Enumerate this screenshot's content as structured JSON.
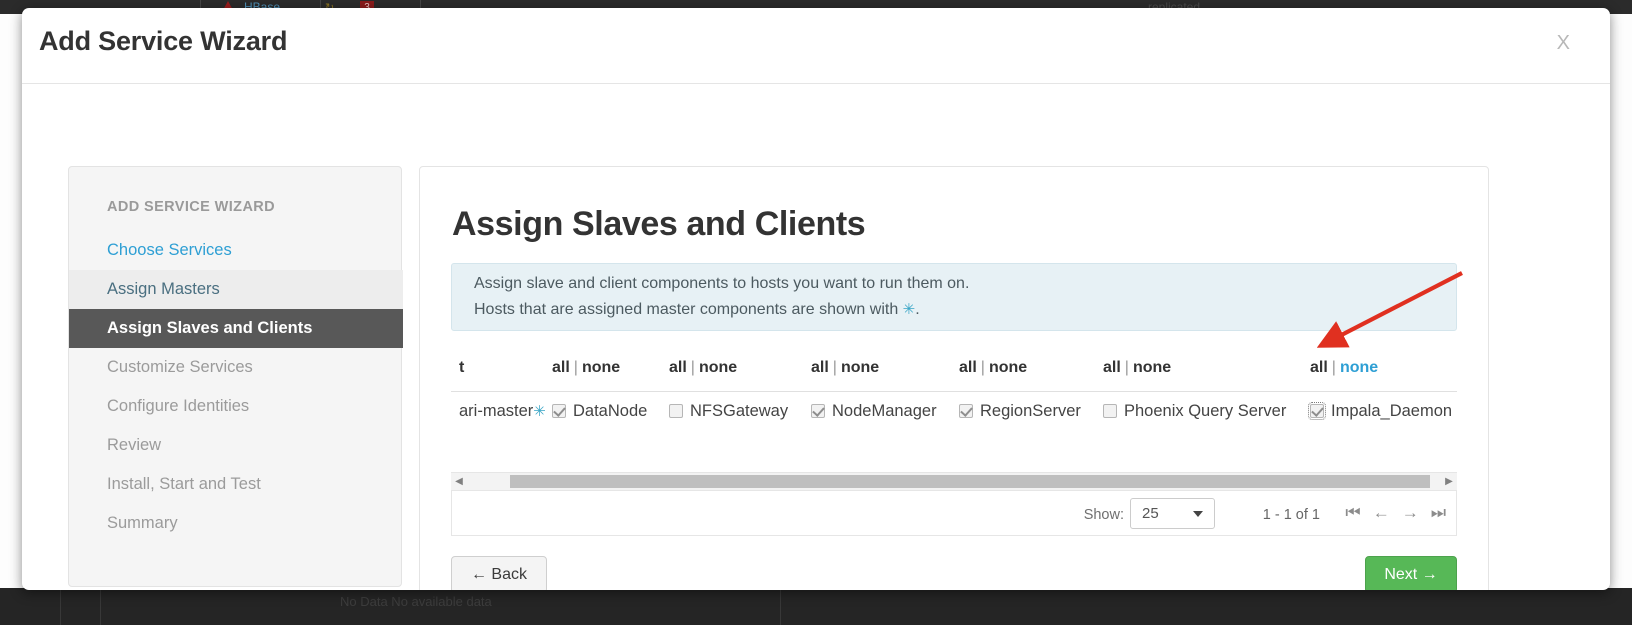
{
  "background": {
    "top_row": {
      "service_name": "HBase",
      "alert_icon": "warning-triangle-icon",
      "refresh_icon": "refresh-icon",
      "badge_count": "3",
      "right_label": "replicated"
    },
    "bottom_row": {
      "no_data_text": "No Data No available data"
    }
  },
  "modal": {
    "title": "Add Service Wizard",
    "close_label": "X"
  },
  "sidebar": {
    "title": "ADD SERVICE WIZARD",
    "items": [
      {
        "label": "Choose Services",
        "state": "done"
      },
      {
        "label": "Assign Masters",
        "state": "prev"
      },
      {
        "label": "Assign Slaves and Clients",
        "state": "active"
      },
      {
        "label": "Customize Services",
        "state": "upcoming"
      },
      {
        "label": "Configure Identities",
        "state": "upcoming"
      },
      {
        "label": "Review",
        "state": "upcoming"
      },
      {
        "label": "Install, Start and Test",
        "state": "upcoming"
      },
      {
        "label": "Summary",
        "state": "upcoming"
      }
    ]
  },
  "main": {
    "page_title": "Assign Slaves and Clients",
    "info": {
      "line1": "Assign slave and client components to hosts you want to run them on.",
      "line2_pre": "Hosts that are assigned master components are shown with ",
      "line2_star": "✳",
      "line2_post": "."
    },
    "table": {
      "header_host_partial": "t",
      "all_label": "all",
      "separator": "|",
      "none_label": "none",
      "columns": [
        {
          "component": "DataNode",
          "all": "all",
          "none": "none",
          "none_active": false,
          "checked": true,
          "focused": false
        },
        {
          "component": "NFSGateway",
          "all": "all",
          "none": "none",
          "none_active": false,
          "checked": false,
          "focused": false
        },
        {
          "component": "NodeManager",
          "all": "all",
          "none": "none",
          "none_active": false,
          "checked": true,
          "focused": false
        },
        {
          "component": "RegionServer",
          "all": "all",
          "none": "none",
          "none_active": false,
          "checked": true,
          "focused": false
        },
        {
          "component": "Phoenix Query Server",
          "all": "all",
          "none": "none",
          "none_active": false,
          "checked": false,
          "focused": false
        },
        {
          "component": "Impala_Daemon",
          "all": "all",
          "none": "none",
          "none_active": true,
          "checked": true,
          "focused": true
        }
      ],
      "row": {
        "host_partial": "ari-master",
        "master_star": "✳"
      }
    },
    "scrollbar": {
      "left_arrow": "◀",
      "right_arrow": "▶"
    },
    "footer": {
      "show_label": "Show:",
      "page_size": "25",
      "range": "1 - 1 of 1",
      "pager": {
        "first": "⏮",
        "prev": "←",
        "next": "→",
        "last": "⏭"
      }
    },
    "buttons": {
      "back": "← Back",
      "next": "Next →"
    }
  },
  "annotation": {
    "arrow_color": "#e03020",
    "points_at": "Impala_Daemon checkbox"
  },
  "colors": {
    "accent_link": "#2e9fd4",
    "active_step_bg": "#585858",
    "next_button": "#57b857",
    "info_box_bg": "#e7f1f5",
    "annotation_red": "#e03020"
  }
}
